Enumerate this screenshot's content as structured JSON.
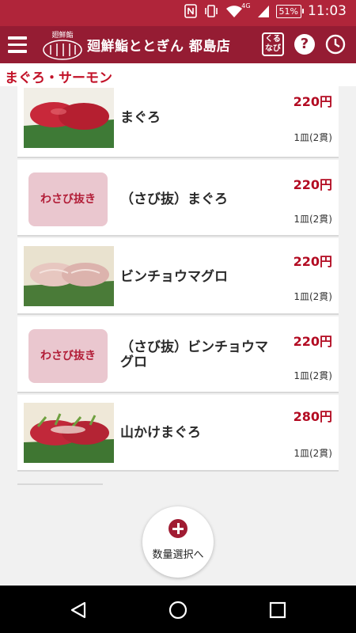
{
  "status_bar": {
    "network": "4G",
    "battery": "51%",
    "time": "11:03"
  },
  "app_bar": {
    "logo_text": "廻鮮鮨",
    "shop_name": "廻鮮鮨ととぎん 都島店",
    "kuru_label": "くるなび",
    "help_label": "?"
  },
  "section_title": "まぐろ・サーモン",
  "items": [
    {
      "name": "まぐろ",
      "price": "220円",
      "unit": "1皿(2貫)",
      "image": "maguro-photo"
    },
    {
      "badge": "わさび抜き",
      "name": "（さび抜）まぐろ",
      "price": "220円",
      "unit": "1皿(2貫)"
    },
    {
      "name": "ビンチョウマグロ",
      "price": "220円",
      "unit": "1皿(2貫)",
      "image": "binchou-photo"
    },
    {
      "badge": "わさび抜き",
      "name": "（さび抜）ビンチョウマグロ",
      "price": "220円",
      "unit": "1皿(2貫)"
    },
    {
      "name": "山かけまぐろ",
      "price": "280円",
      "unit": "1皿(2貫)",
      "image": "yamakake-photo"
    }
  ],
  "quantity_button": {
    "label": "数量選択へ"
  },
  "colors": {
    "header": "#951c33",
    "status": "#b0253a",
    "price": "#b30b22",
    "accent": "#c21228"
  }
}
